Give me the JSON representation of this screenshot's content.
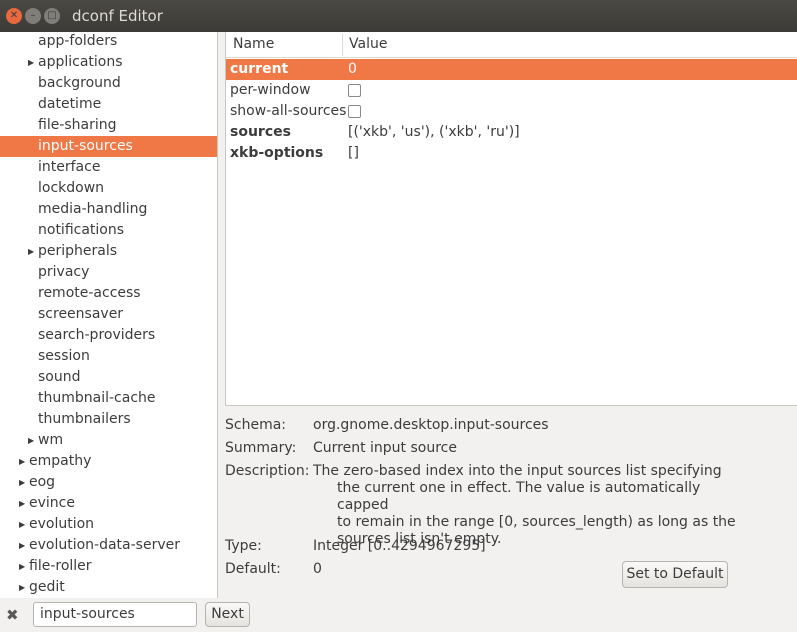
{
  "window": {
    "title": "dconf Editor"
  },
  "tree": {
    "items": [
      {
        "label": "app-folders",
        "indent": 1,
        "expander": false
      },
      {
        "label": "applications",
        "indent": 1,
        "expander": true
      },
      {
        "label": "background",
        "indent": 1,
        "expander": false
      },
      {
        "label": "datetime",
        "indent": 1,
        "expander": false
      },
      {
        "label": "file-sharing",
        "indent": 1,
        "expander": false
      },
      {
        "label": "input-sources",
        "indent": 1,
        "expander": false,
        "selected": true
      },
      {
        "label": "interface",
        "indent": 1,
        "expander": false
      },
      {
        "label": "lockdown",
        "indent": 1,
        "expander": false
      },
      {
        "label": "media-handling",
        "indent": 1,
        "expander": false
      },
      {
        "label": "notifications",
        "indent": 1,
        "expander": false
      },
      {
        "label": "peripherals",
        "indent": 1,
        "expander": true
      },
      {
        "label": "privacy",
        "indent": 1,
        "expander": false
      },
      {
        "label": "remote-access",
        "indent": 1,
        "expander": false
      },
      {
        "label": "screensaver",
        "indent": 1,
        "expander": false
      },
      {
        "label": "search-providers",
        "indent": 1,
        "expander": false
      },
      {
        "label": "session",
        "indent": 1,
        "expander": false
      },
      {
        "label": "sound",
        "indent": 1,
        "expander": false
      },
      {
        "label": "thumbnail-cache",
        "indent": 1,
        "expander": false
      },
      {
        "label": "thumbnailers",
        "indent": 1,
        "expander": false
      },
      {
        "label": "wm",
        "indent": 1,
        "expander": true
      },
      {
        "label": "empathy",
        "indent": 0,
        "expander": true
      },
      {
        "label": "eog",
        "indent": 0,
        "expander": true
      },
      {
        "label": "evince",
        "indent": 0,
        "expander": true
      },
      {
        "label": "evolution",
        "indent": 0,
        "expander": true
      },
      {
        "label": "evolution-data-server",
        "indent": 0,
        "expander": true
      },
      {
        "label": "file-roller",
        "indent": 0,
        "expander": true
      },
      {
        "label": "gedit",
        "indent": 0,
        "expander": true
      }
    ]
  },
  "keys": {
    "name_header": "Name",
    "value_header": "Value",
    "rows": [
      {
        "name": "current",
        "value": "0",
        "bold": true,
        "selected": true
      },
      {
        "name": "per-window",
        "checkbox": true,
        "checked": false
      },
      {
        "name": "show-all-sources",
        "checkbox": true,
        "checked": false
      },
      {
        "name": "sources",
        "value": "[('xkb', 'us'), ('xkb', 'ru')]",
        "bold": true
      },
      {
        "name": "xkb-options",
        "value": "[]",
        "bold": true
      }
    ]
  },
  "details": {
    "schema_label": "Schema:",
    "schema_value": "org.gnome.desktop.input-sources",
    "summary_label": "Summary:",
    "summary_value": "Current input source",
    "description_label": "Description:",
    "description_lines": [
      "The zero-based index into the input sources list specifying",
      "the current one in effect. The value is automatically capped",
      "to remain in the range [0, sources_length) as long as the",
      "sources list isn't empty."
    ],
    "type_label": "Type:",
    "type_value": "Integer [0..4294967295]",
    "default_label": "Default:",
    "default_value": "0",
    "set_default_button": "Set to Default"
  },
  "find": {
    "value": "input-sources",
    "next_label": "Next",
    "close_icon": "close-icon"
  },
  "colors": {
    "selection": "#f07746",
    "titlebar": "#3c3b37"
  }
}
